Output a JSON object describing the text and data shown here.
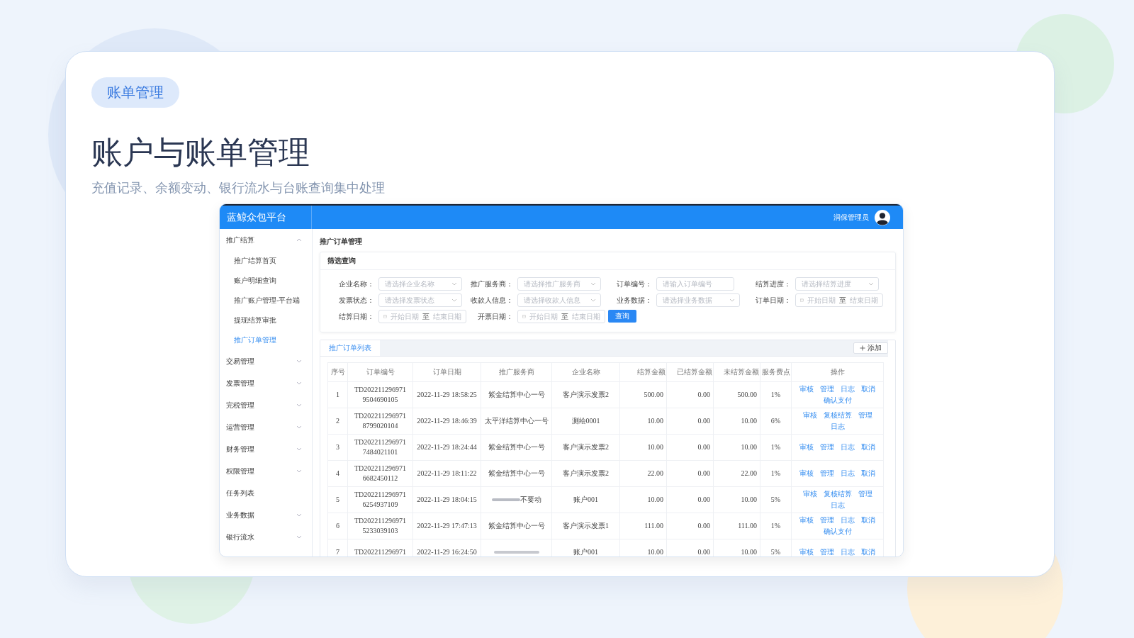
{
  "slide": {
    "tag": "账单管理",
    "title": "账户与账单管理",
    "subtitle": "充值记录、余额变动、银行流水与台账查询集中处理"
  },
  "app": {
    "brand": "蓝鲸众包平台",
    "user": "润保管理员",
    "sidebar": [
      {
        "label": "推广结算",
        "kind": "group",
        "expanded": true,
        "children": [
          {
            "label": "推广结算首页",
            "selected": false
          },
          {
            "label": "账户明细查询",
            "selected": false
          },
          {
            "label": "推广账户管理-平台端",
            "selected": false
          },
          {
            "label": "提现结算审批",
            "selected": false
          },
          {
            "label": "推广订单管理",
            "selected": true
          }
        ]
      },
      {
        "label": "交易管理",
        "kind": "group",
        "expanded": false
      },
      {
        "label": "发票管理",
        "kind": "group",
        "expanded": false
      },
      {
        "label": "完税管理",
        "kind": "group",
        "expanded": false
      },
      {
        "label": "运营管理",
        "kind": "group",
        "expanded": false
      },
      {
        "label": "财务管理",
        "kind": "group",
        "expanded": false
      },
      {
        "label": "权限管理",
        "kind": "group",
        "expanded": false
      },
      {
        "label": "任务列表",
        "kind": "link"
      },
      {
        "label": "业务数据",
        "kind": "group",
        "expanded": false
      },
      {
        "label": "银行流水",
        "kind": "group",
        "expanded": false
      }
    ],
    "page_title": "推广订单管理",
    "filter": {
      "title": "筛选查询",
      "search_button": "查询",
      "fields": [
        {
          "label": "企业名称：",
          "kind": "select",
          "placeholder": "请选择企业名称"
        },
        {
          "label": "推广服务商：",
          "kind": "select",
          "placeholder": "请选择推广服务商"
        },
        {
          "label": "订单编号：",
          "kind": "input",
          "placeholder": "请输入订单编号"
        },
        {
          "label": "结算进度：",
          "kind": "select",
          "placeholder": "请选择结算进度"
        },
        {
          "label": "发票状态：",
          "kind": "select",
          "placeholder": "请选择发票状态"
        },
        {
          "label": "收款人信息：",
          "kind": "select",
          "placeholder": "请选择收款人信息"
        },
        {
          "label": "业务数据：",
          "kind": "select",
          "placeholder": "请选择业务数据"
        },
        {
          "label": "订单日期：",
          "kind": "daterange",
          "start_placeholder": "开始日期",
          "separator": "至",
          "end_placeholder": "结束日期"
        },
        {
          "label": "结算日期：",
          "kind": "daterange",
          "start_placeholder": "开始日期",
          "separator": "至",
          "end_placeholder": "结束日期"
        },
        {
          "label": "开票日期：",
          "kind": "daterange",
          "start_placeholder": "开始日期",
          "separator": "至",
          "end_placeholder": "结束日期"
        }
      ]
    },
    "table": {
      "tab": {
        "label": "推广订单列表",
        "selected": true
      },
      "add_button": "添加",
      "columns": [
        "序号",
        "订单编号",
        "订单日期",
        "推广服务商",
        "企业名称",
        "结算金额",
        "已结算金额",
        "未结算金额",
        "服务费点",
        "操作"
      ],
      "rows": [
        {
          "index": "1",
          "order_no": [
            "TD202211296971",
            "9504690105"
          ],
          "date": "2022-11-29 18:58:25",
          "provider": "紫金结算中心一号",
          "company": "客户演示发票2",
          "amount": "500.00",
          "settled": "0.00",
          "unsettled": "500.00",
          "fee": "1%",
          "actions": [
            "审核",
            "管理",
            "日志",
            "取消",
            "确认支付"
          ]
        },
        {
          "index": "2",
          "order_no": [
            "TD202211296971",
            "8799020104"
          ],
          "date": "2022-11-29 18:46:39",
          "provider": "太平洋结算中心一号",
          "company": "测绘0001",
          "amount": "10.00",
          "settled": "0.00",
          "unsettled": "10.00",
          "fee": "6%",
          "actions": [
            "审核",
            "复核结算",
            "管理",
            "日志"
          ]
        },
        {
          "index": "3",
          "order_no": [
            "TD202211296971",
            "7484021101"
          ],
          "date": "2022-11-29 18:24:44",
          "provider": "紫金结算中心一号",
          "company": "客户演示发票2",
          "amount": "10.00",
          "settled": "0.00",
          "unsettled": "10.00",
          "fee": "1%",
          "actions": [
            "审核",
            "管理",
            "日志",
            "取消"
          ]
        },
        {
          "index": "4",
          "order_no": [
            "TD202211296971",
            "6682450112"
          ],
          "date": "2022-11-29 18:11:22",
          "provider": "紫金结算中心一号",
          "company": "客户演示发票2",
          "amount": "22.00",
          "settled": "0.00",
          "unsettled": "22.00",
          "fee": "1%",
          "actions": [
            "审核",
            "管理",
            "日志",
            "取消"
          ]
        },
        {
          "index": "5",
          "order_no": [
            "TD202211296971",
            "6254937109"
          ],
          "date": "2022-11-29 18:04:15",
          "redacted": true,
          "provider": "不要动",
          "company": "账户001",
          "amount": "10.00",
          "settled": "0.00",
          "unsettled": "10.00",
          "fee": "5%",
          "actions": [
            "审核",
            "复核结算",
            "管理",
            "日志"
          ]
        },
        {
          "index": "6",
          "order_no": [
            "TD202211296971",
            "5233039103"
          ],
          "date": "2022-11-29 17:47:13",
          "provider": "紫金结算中心一号",
          "company": "客户演示发票1",
          "amount": "111.00",
          "settled": "0.00",
          "unsettled": "111.00",
          "fee": "1%",
          "actions": [
            "审核",
            "管理",
            "日志",
            "取消",
            "确认支付"
          ]
        },
        {
          "index": "7",
          "order_no": [
            "TD202211296971"
          ],
          "date": "2022-11-29 16:24:50",
          "redacted": true,
          "company": "账户001",
          "amount": "10.00",
          "settled": "0.00",
          "unsettled": "10.00",
          "fee": "5%",
          "actions": [
            "审核",
            "管理",
            "日志",
            "取消"
          ]
        }
      ]
    }
  }
}
